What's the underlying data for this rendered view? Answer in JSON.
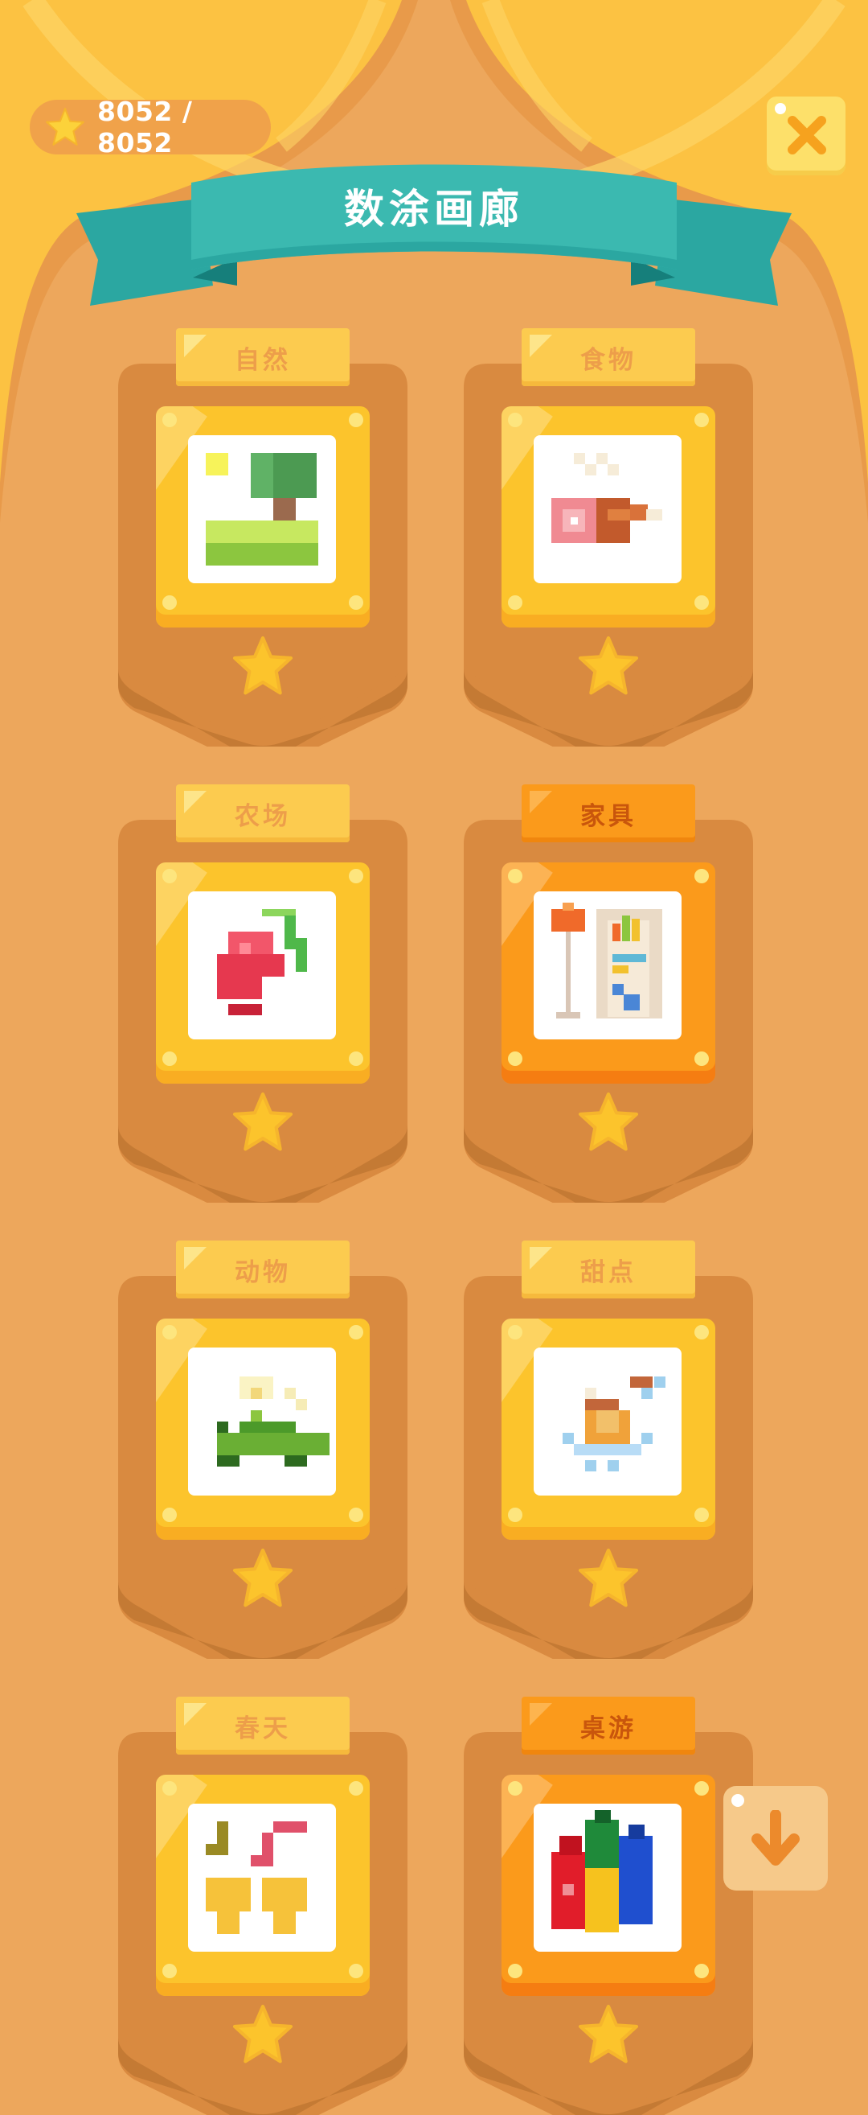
{
  "header": {
    "score_text": "8052 / 8052",
    "score_icon": "star-icon",
    "close_icon": "close-icon",
    "title": "数涂画廊"
  },
  "categories": [
    {
      "label": "自然",
      "artwork": "landscape-tree-pixel-art",
      "highlighted": false
    },
    {
      "label": "食物",
      "artwork": "ham-pixel-art",
      "highlighted": false
    },
    {
      "label": "农场",
      "artwork": "radish-pixel-art",
      "highlighted": false
    },
    {
      "label": "家具",
      "artwork": "shelf-lamp-pixel-art",
      "highlighted": true
    },
    {
      "label": "动物",
      "artwork": "turtle-pixel-art",
      "highlighted": false
    },
    {
      "label": "甜点",
      "artwork": "cake-pixel-art",
      "highlighted": false
    },
    {
      "label": "春天",
      "artwork": "music-flowers-pixel-art",
      "highlighted": false
    },
    {
      "label": "桌游",
      "artwork": "chess-pieces-pixel-art",
      "highlighted": true
    }
  ],
  "scroll_button_icon": "arrow-down-icon",
  "colors": {
    "background": "#eda75c",
    "curtain": "#fcc242",
    "banner": "#3bb9b0",
    "card": "#d98a40",
    "frame_gold": "#fcc42c",
    "frame_orange": "#fb9a1b"
  }
}
